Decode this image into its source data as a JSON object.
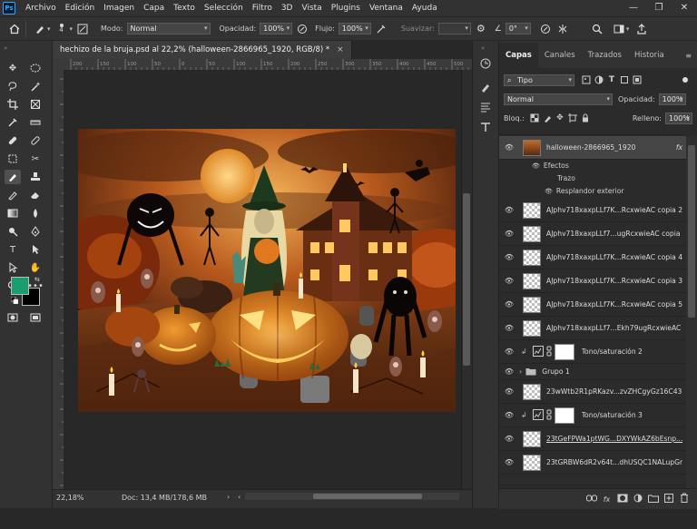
{
  "menubar": {
    "logo": "Ps",
    "items": [
      "Archivo",
      "Edición",
      "Imagen",
      "Capa",
      "Texto",
      "Selección",
      "Filtro",
      "3D",
      "Vista",
      "Plugins",
      "Ventana",
      "Ayuda"
    ],
    "window_controls": [
      "—",
      "❐",
      "✕"
    ]
  },
  "options": {
    "brush_size": "4",
    "mode_label": "Modo:",
    "mode_value": "Normal",
    "opacity_label": "Opacidad:",
    "opacity_value": "100%",
    "flow_label": "Flujo:",
    "flow_value": "100%",
    "smooth_label": "Suavizar:",
    "smooth_value": "",
    "angle_value": "0°"
  },
  "document": {
    "tab_title": "hechizo de la bruja.psd al 22,2% (halloween-2866965_1920, RGB/8) *",
    "close": "×"
  },
  "ruler_top_ticks": [
    "200",
    "150",
    "100",
    "50",
    "0",
    "50",
    "100",
    "150",
    "200",
    "250",
    "300",
    "350",
    "400",
    "450",
    "500"
  ],
  "status": {
    "zoom": "22,18%",
    "doc_info": "Doc: 13,4 MB/178,6 MB",
    "arrow": "›"
  },
  "colors": {
    "foreground": "#1a9e6e",
    "background": "#000000"
  },
  "panel": {
    "tabs": [
      "Capas",
      "Canales",
      "Trazados",
      "Historia"
    ],
    "filter_label": "Tipo",
    "blend_mode": "Normal",
    "opacity_label": "Opacidad:",
    "opacity_value": "100%",
    "lock_label": "Bloq.:",
    "fill_label": "Relleno:",
    "fill_value": "100%"
  },
  "layers": {
    "selected": {
      "name": "halloween-2866965_1920",
      "fx": "fx"
    },
    "effects_label": "Efectos",
    "effects": [
      "Trazo",
      "Resplandor exterior"
    ],
    "items": [
      {
        "name": "AJphv718xaxpLLf7K...RcxwieAC copia 2"
      },
      {
        "name": "AJphv718xaxpLLf7...ugRcxwieAC copia"
      },
      {
        "name": "AJphv718xaxpLLf7K...RcxwieAC copia 4"
      },
      {
        "name": "AJphv718xaxpLLf7K...RcxwieAC copia 3"
      },
      {
        "name": "AJphv718xaxpLLf7K...RcxwieAC copia 5"
      },
      {
        "name": "AJphv718xaxpLLf7...Ekh79ugRcxwieAC"
      }
    ],
    "adjust1": "Tono/saturación 2",
    "group": "Grupo 1",
    "item_g1": "23wWtb2R1pRKazv...zvZHCgyGz16C43",
    "adjust2": "Tono/saturación 3",
    "item_g2": "23tGeFPWa1ptWG...DXYWkAZ6bEsnp...",
    "item_g3": "23tGRBW6dR2v64t...dhUSQC1NALupGr"
  },
  "bottom_icons": [
    "link-icon",
    "fx-icon",
    "mask-icon",
    "adjustment-icon",
    "folder-icon",
    "new-layer-icon",
    "trash-icon"
  ]
}
